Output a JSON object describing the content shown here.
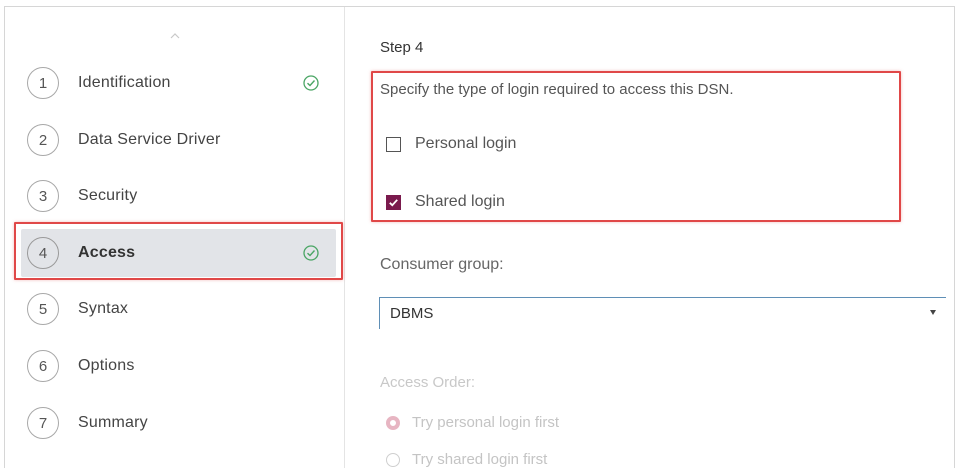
{
  "sidebar": {
    "steps": [
      {
        "number": "1",
        "label": "Identification",
        "complete": true,
        "active": false
      },
      {
        "number": "2",
        "label": "Data Service Driver",
        "complete": false,
        "active": false
      },
      {
        "number": "3",
        "label": "Security",
        "complete": false,
        "active": false
      },
      {
        "number": "4",
        "label": "Access",
        "complete": true,
        "active": true
      },
      {
        "number": "5",
        "label": "Syntax",
        "complete": false,
        "active": false
      },
      {
        "number": "6",
        "label": "Options",
        "complete": false,
        "active": false
      },
      {
        "number": "7",
        "label": "Summary",
        "complete": false,
        "active": false
      }
    ],
    "scroll_icon": "chevron-up-icon",
    "complete_icon": "check-circle-icon"
  },
  "main": {
    "step_title": "Step 4",
    "instruction": "Specify the type of login required to access this DSN.",
    "options": [
      {
        "label": "Personal login",
        "checked": false
      },
      {
        "label": "Shared login",
        "checked": true
      }
    ],
    "consumer_group": {
      "label": "Consumer group:",
      "value": "DBMS"
    },
    "access_order": {
      "label": "Access Order:",
      "disabled": true,
      "options": [
        {
          "label": "Try personal login first",
          "selected": true
        },
        {
          "label": "Try shared login first",
          "selected": false
        }
      ]
    }
  },
  "colors": {
    "highlight": "#e04848",
    "checkbox_checked": "#7a1a4d",
    "check_icon": "#4aa564",
    "active_step_bg": "#e2e4e8",
    "select_border": "#5f8fb6"
  }
}
